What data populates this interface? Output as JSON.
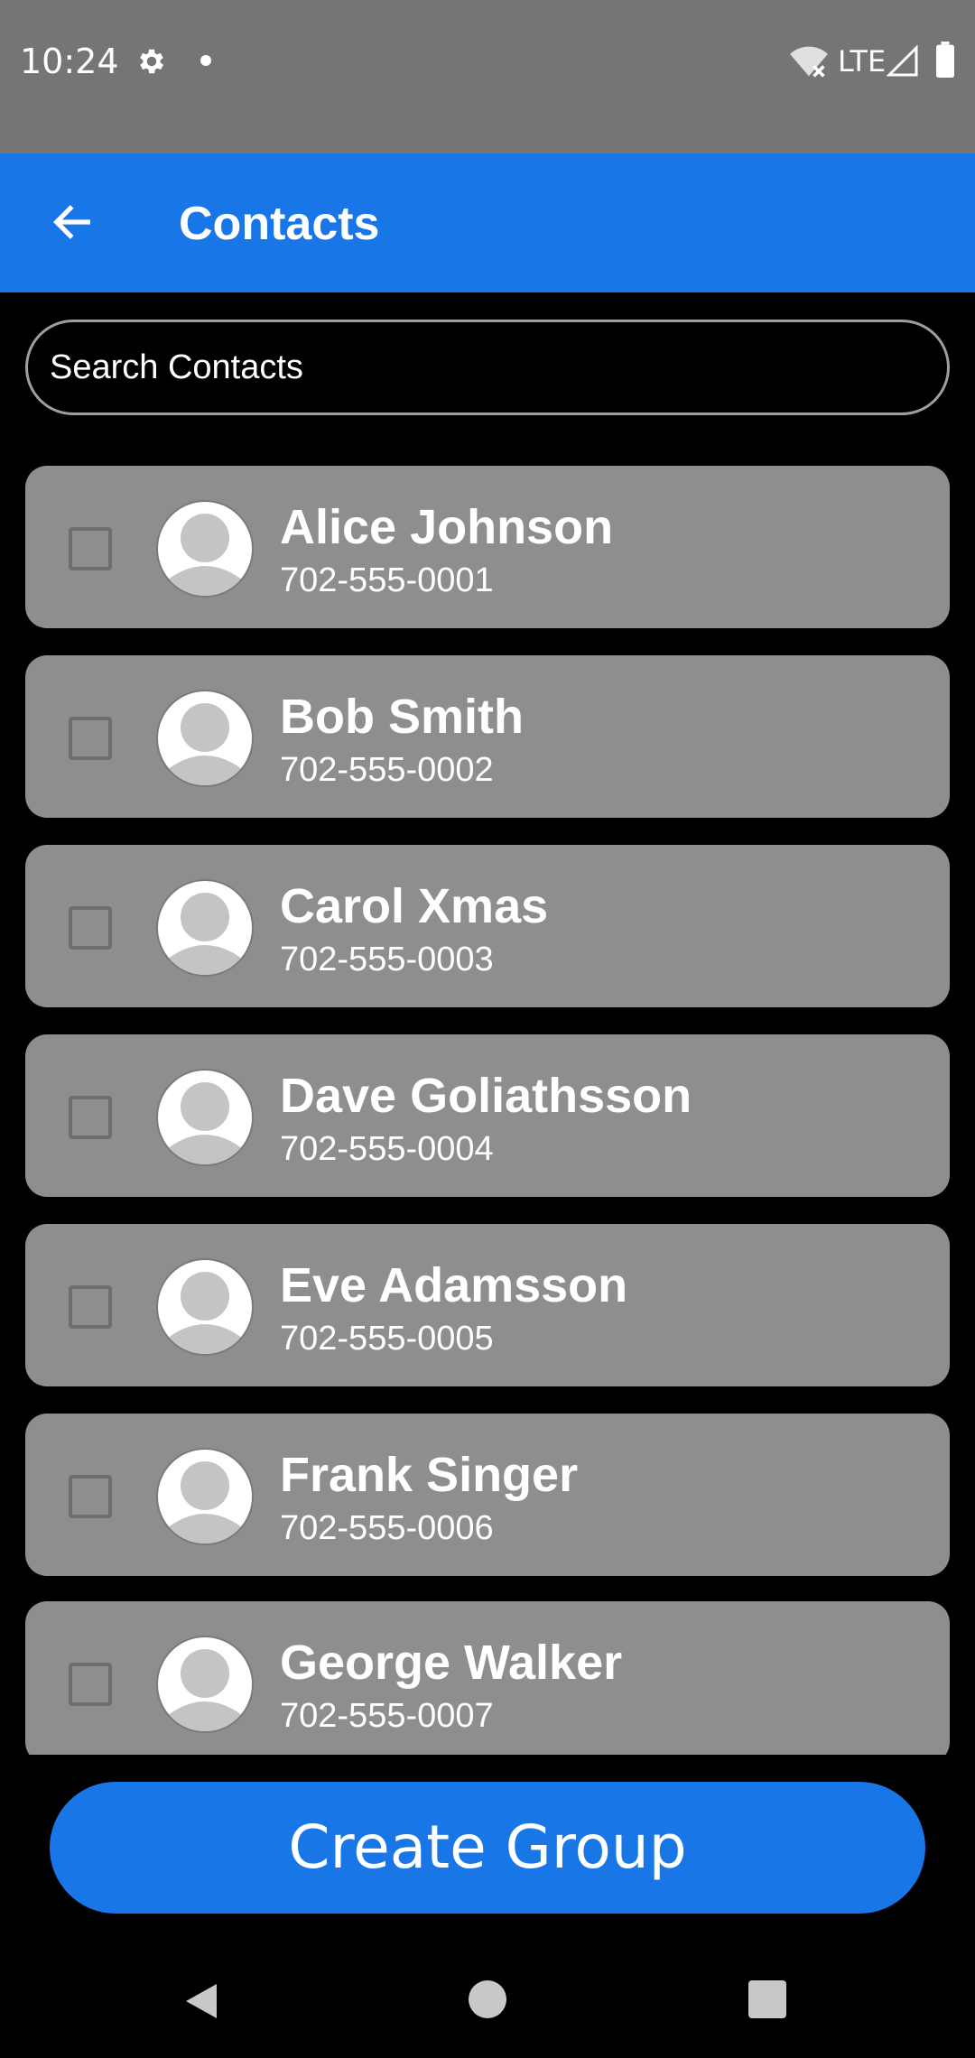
{
  "status_bar": {
    "time": "10:24",
    "network_label": "LTE",
    "icons": [
      "gear-icon",
      "notification-dot-icon",
      "wifi-off-icon",
      "signal-icon",
      "battery-icon"
    ]
  },
  "app_bar": {
    "title": "Contacts",
    "back_icon": "arrow-left-icon"
  },
  "search": {
    "placeholder": "Search Contacts",
    "value": ""
  },
  "contacts": [
    {
      "name": "Alice Johnson",
      "phone": "702-555-0001",
      "checked": false
    },
    {
      "name": "Bob Smith",
      "phone": "702-555-0002",
      "checked": false
    },
    {
      "name": "Carol Xmas",
      "phone": "702-555-0003",
      "checked": false
    },
    {
      "name": "Dave Goliathsson",
      "phone": "702-555-0004",
      "checked": false
    },
    {
      "name": "Eve Adamsson",
      "phone": "702-555-0005",
      "checked": false
    },
    {
      "name": "Frank Singer",
      "phone": "702-555-0006",
      "checked": false
    },
    {
      "name": "George Walker",
      "phone": "702-555-0007",
      "checked": false
    }
  ],
  "actions": {
    "create_group_label": "Create Group"
  },
  "colors": {
    "primary": "#1976e6",
    "status_bar": "#757575",
    "card": "#8e8e8e",
    "background": "#000000",
    "text": "#ffffff"
  }
}
